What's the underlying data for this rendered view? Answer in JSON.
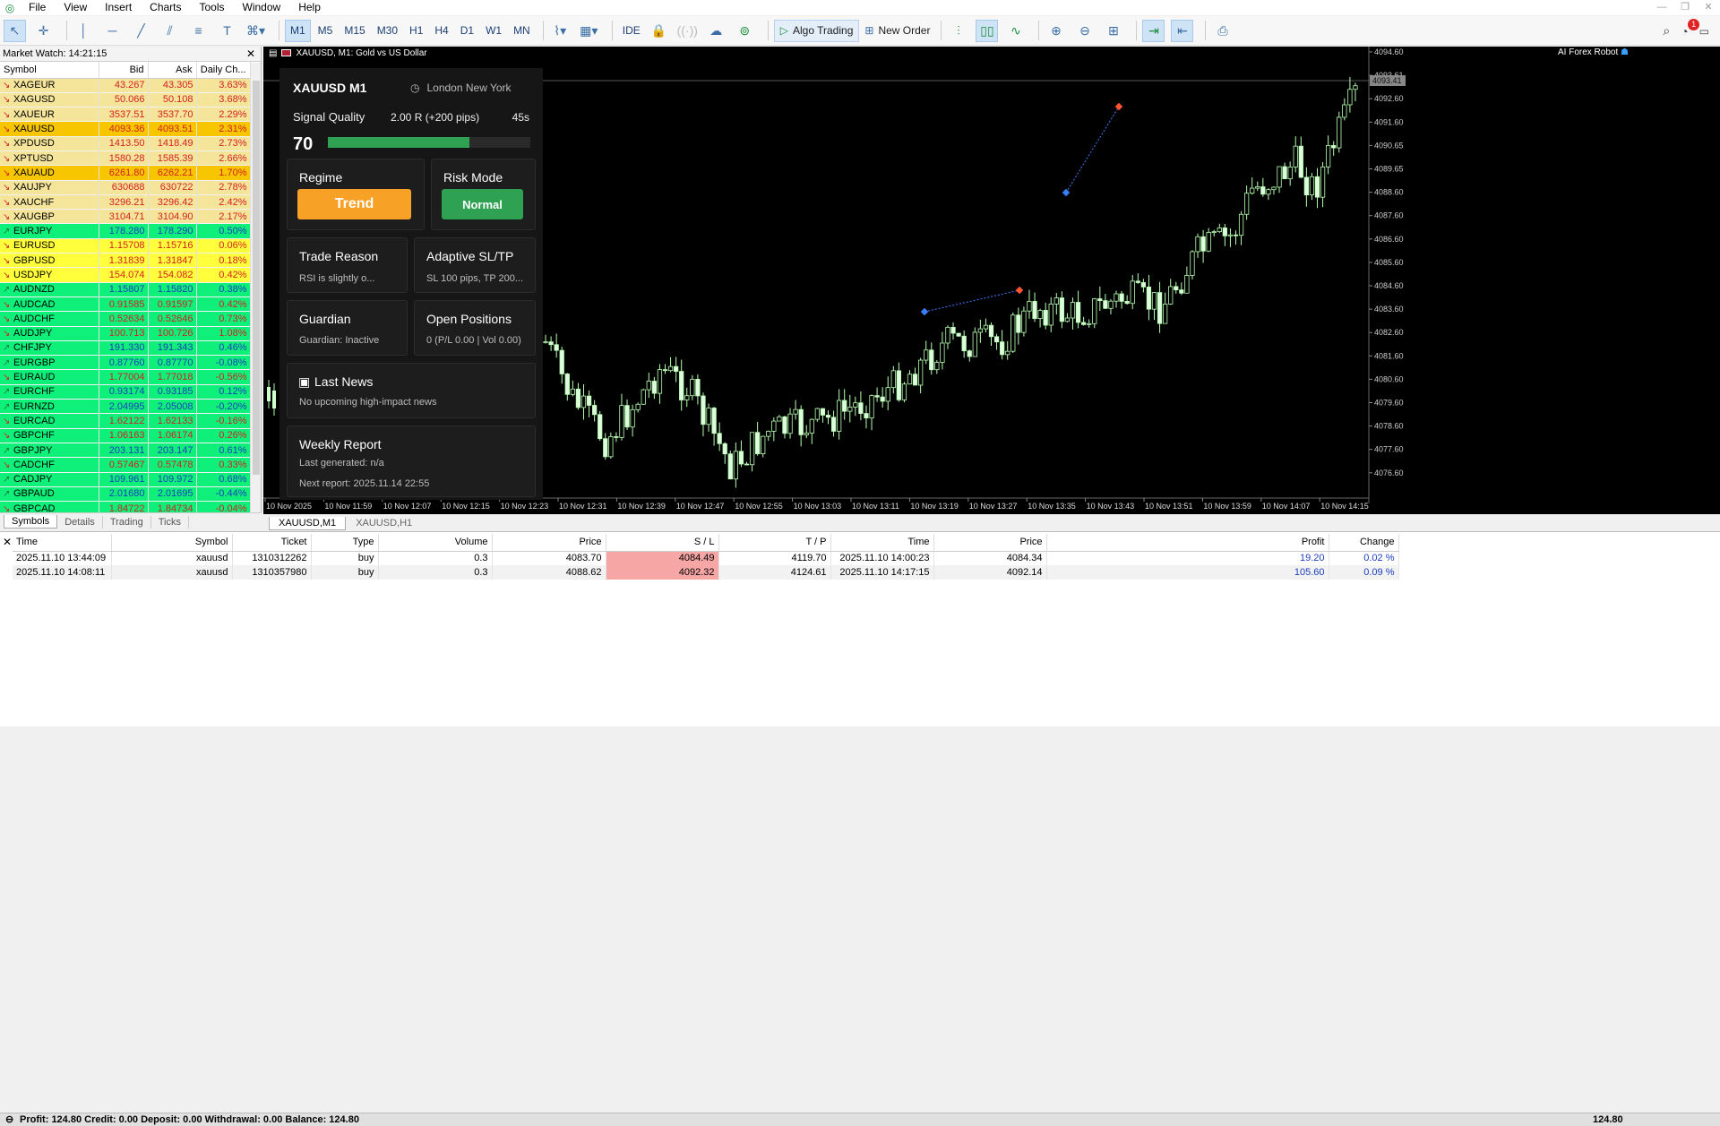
{
  "menu": [
    "File",
    "View",
    "Insert",
    "Charts",
    "Tools",
    "Window",
    "Help"
  ],
  "toolbar": {
    "timeframes": [
      "M1",
      "M5",
      "M15",
      "M30",
      "H1",
      "H4",
      "D1",
      "W1",
      "MN"
    ],
    "active_timeframe": "M1",
    "ide_label": "IDE",
    "algo_label": "Algo Trading",
    "neworder_label": "New Order",
    "notification_count": "1"
  },
  "market_watch": {
    "title": "Market Watch: 14:21:15",
    "columns": [
      "Symbol",
      "Bid",
      "Ask",
      "Daily Ch..."
    ],
    "rows": [
      {
        "s": "XAGEUR",
        "b": "43.267",
        "a": "43.305",
        "c": "3.63%",
        "dir": "down",
        "bg": "#f5e59b",
        "pc": "#d42020"
      },
      {
        "s": "XAGUSD",
        "b": "50.066",
        "a": "50.108",
        "c": "3.68%",
        "dir": "down",
        "bg": "#f5e59b",
        "pc": "#d42020"
      },
      {
        "s": "XAUEUR",
        "b": "3537.51",
        "a": "3537.70",
        "c": "2.29%",
        "dir": "down",
        "bg": "#f5e59b",
        "pc": "#d42020"
      },
      {
        "s": "XAUUSD",
        "b": "4093.36",
        "a": "4093.51",
        "c": "2.31%",
        "dir": "down",
        "bg": "#f7c600",
        "pc": "#d42020"
      },
      {
        "s": "XPDUSD",
        "b": "1413.50",
        "a": "1418.49",
        "c": "2.73%",
        "dir": "down",
        "bg": "#f5e59b",
        "pc": "#d42020"
      },
      {
        "s": "XPTUSD",
        "b": "1580.28",
        "a": "1585.39",
        "c": "2.66%",
        "dir": "down",
        "bg": "#f5e59b",
        "pc": "#d42020"
      },
      {
        "s": "XAUAUD",
        "b": "6261.80",
        "a": "6262.21",
        "c": "1.70%",
        "dir": "down",
        "bg": "#f7c600",
        "pc": "#d42020"
      },
      {
        "s": "XAUJPY",
        "b": "630688",
        "a": "630722",
        "c": "2.78%",
        "dir": "down",
        "bg": "#f5e59b",
        "pc": "#d42020"
      },
      {
        "s": "XAUCHF",
        "b": "3296.21",
        "a": "3296.42",
        "c": "2.42%",
        "dir": "down",
        "bg": "#f5e59b",
        "pc": "#d42020"
      },
      {
        "s": "XAUGBP",
        "b": "3104.71",
        "a": "3104.90",
        "c": "2.17%",
        "dir": "down",
        "bg": "#f5e59b",
        "pc": "#d42020"
      },
      {
        "s": "EURJPY",
        "b": "178.280",
        "a": "178.290",
        "c": "0.50%",
        "dir": "up",
        "bg": "#0ff07a",
        "pc": "#1c3fbf"
      },
      {
        "s": "EURUSD",
        "b": "1.15708",
        "a": "1.15716",
        "c": "0.06%",
        "dir": "down",
        "bg": "#ffff3c",
        "pc": "#d42020"
      },
      {
        "s": "GBPUSD",
        "b": "1.31839",
        "a": "1.31847",
        "c": "0.18%",
        "dir": "down",
        "bg": "#ffff3c",
        "pc": "#d42020"
      },
      {
        "s": "USDJPY",
        "b": "154.074",
        "a": "154.082",
        "c": "0.42%",
        "dir": "down",
        "bg": "#ffff3c",
        "pc": "#d42020"
      },
      {
        "s": "AUDNZD",
        "b": "1.15807",
        "a": "1.15820",
        "c": "0.38%",
        "dir": "up",
        "bg": "#0ff07a",
        "pc": "#1c3fbf"
      },
      {
        "s": "AUDCAD",
        "b": "0.91585",
        "a": "0.91597",
        "c": "0.42%",
        "dir": "down",
        "bg": "#0ff07a",
        "pc": "#d42020"
      },
      {
        "s": "AUDCHF",
        "b": "0.52634",
        "a": "0.52646",
        "c": "0.73%",
        "dir": "down",
        "bg": "#0ff07a",
        "pc": "#d42020"
      },
      {
        "s": "AUDJPY",
        "b": "100.713",
        "a": "100.726",
        "c": "1.08%",
        "dir": "down",
        "bg": "#0ff07a",
        "pc": "#d42020"
      },
      {
        "s": "CHFJPY",
        "b": "191.330",
        "a": "191.343",
        "c": "0.46%",
        "dir": "up",
        "bg": "#0ff07a",
        "pc": "#1c3fbf"
      },
      {
        "s": "EURGBP",
        "b": "0.87760",
        "a": "0.87770",
        "c": "-0.08%",
        "dir": "up",
        "bg": "#0ff07a",
        "pc": "#1c3fbf"
      },
      {
        "s": "EURAUD",
        "b": "1.77004",
        "a": "1.77018",
        "c": "-0.56%",
        "dir": "down",
        "bg": "#0ff07a",
        "pc": "#d42020"
      },
      {
        "s": "EURCHF",
        "b": "0.93174",
        "a": "0.93185",
        "c": "0.12%",
        "dir": "up",
        "bg": "#0ff07a",
        "pc": "#1c3fbf"
      },
      {
        "s": "EURNZD",
        "b": "2.04995",
        "a": "2.05008",
        "c": "-0.20%",
        "dir": "up",
        "bg": "#0ff07a",
        "pc": "#1c3fbf"
      },
      {
        "s": "EURCAD",
        "b": "1.62122",
        "a": "1.62133",
        "c": "-0.16%",
        "dir": "down",
        "bg": "#0ff07a",
        "pc": "#d42020"
      },
      {
        "s": "GBPCHF",
        "b": "1.06163",
        "a": "1.06174",
        "c": "0.26%",
        "dir": "down",
        "bg": "#0ff07a",
        "pc": "#d42020"
      },
      {
        "s": "GBPJPY",
        "b": "203.131",
        "a": "203.147",
        "c": "0.61%",
        "dir": "up",
        "bg": "#0ff07a",
        "pc": "#1c3fbf"
      },
      {
        "s": "CADCHF",
        "b": "0.57467",
        "a": "0.57478",
        "c": "0.33%",
        "dir": "down",
        "bg": "#0ff07a",
        "pc": "#d42020"
      },
      {
        "s": "CADJPY",
        "b": "109.961",
        "a": "109.972",
        "c": "0.68%",
        "dir": "up",
        "bg": "#0ff07a",
        "pc": "#1c3fbf"
      },
      {
        "s": "GBPAUD",
        "b": "2.01680",
        "a": "2.01695",
        "c": "-0.44%",
        "dir": "up",
        "bg": "#0ff07a",
        "pc": "#1c3fbf"
      },
      {
        "s": "GBPCAD",
        "b": "1.84722",
        "a": "1.84734",
        "c": "-0.04%",
        "dir": "down",
        "bg": "#0ff07a",
        "pc": "#d42020"
      }
    ],
    "tabs": [
      "Symbols",
      "Details",
      "Trading",
      "Ticks"
    ]
  },
  "chart": {
    "title": "XAUUSD, M1:  Gold vs US Dollar",
    "robot_label": "AI Forex Robot",
    "price_ticks": [
      "4094.60",
      "4093.61",
      "4092.60",
      "4091.60",
      "4090.65",
      "4089.65",
      "4088.60",
      "4087.60",
      "4086.60",
      "4085.60",
      "4084.60",
      "4083.60",
      "4082.60",
      "4081.60",
      "4080.60",
      "4079.60",
      "4078.60",
      "4077.60",
      "4076.60"
    ],
    "current_price": "4093.41",
    "time_ticks": [
      "10 Nov 2025",
      "10 Nov 11:59",
      "10 Nov 12:07",
      "10 Nov 12:15",
      "10 Nov 12:23",
      "10 Nov 12:31",
      "10 Nov 12:39",
      "10 Nov 12:47",
      "10 Nov 12:55",
      "10 Nov 13:03",
      "10 Nov 13:11",
      "10 Nov 13:19",
      "10 Nov 13:27",
      "10 Nov 13:35",
      "10 Nov 13:43",
      "10 Nov 13:51",
      "10 Nov 13:59",
      "10 Nov 14:07",
      "10 Nov 14:15"
    ],
    "tabs": [
      "XAUUSD,M1",
      "XAUUSD,H1"
    ]
  },
  "panel": {
    "symbol": "XAUUSD M1",
    "session": "London New York",
    "signal_label": "Signal Quality",
    "rr": "2.00 R (+200 pips)",
    "timer": "45s",
    "score": "70",
    "score_pct": 70,
    "regime_title": "Regime",
    "regime_value": "Trend",
    "risk_title": "Risk Mode",
    "risk_value": "Normal",
    "trade_reason_title": "Trade Reason",
    "trade_reason_value": "RSI is slightly o...",
    "sltp_title": "Adaptive SL/TP",
    "sltp_value": "SL 100 pips, TP 200...",
    "guardian_title": "Guardian",
    "guardian_value": "Guardian: Inactive",
    "open_title": "Open Positions",
    "open_value": "0 (P/L 0.00 | Vol 0.00)",
    "news_title": "Last News",
    "news_value": "No upcoming high-impact news",
    "weekly_title": "Weekly Report",
    "weekly_generated": "Last generated: n/a",
    "weekly_next": "Next report: 2025.11.14 22:55",
    "colors": {
      "trend": "#f7a226",
      "normal": "#2ea153",
      "bar": "#2ea153"
    }
  },
  "trades": {
    "columns": [
      "Time",
      "Symbol",
      "Ticket",
      "Type",
      "Volume",
      "Price",
      "S / L",
      "T / P",
      "Time",
      "Price",
      "Profit",
      "Change"
    ],
    "rows": [
      [
        "2025.11.10 13:44:09",
        "xauusd",
        "1310312262",
        "buy",
        "0.3",
        "4083.70",
        "4084.49",
        "4119.70",
        "2025.11.10 14:00:23",
        "4084.34",
        "19.20",
        "0.02 %"
      ],
      [
        "2025.11.10 14:08:11",
        "xauusd",
        "1310357980",
        "buy",
        "0.3",
        "4088.62",
        "4092.32",
        "4124.61",
        "2025.11.10 14:17:15",
        "4092.14",
        "105.60",
        "0.09 %"
      ]
    ],
    "summary": "Profit: 124.80  Credit: 0.00  Deposit: 0.00  Withdrawal: 0.00  Balance: 124.80",
    "total": "124.80"
  }
}
